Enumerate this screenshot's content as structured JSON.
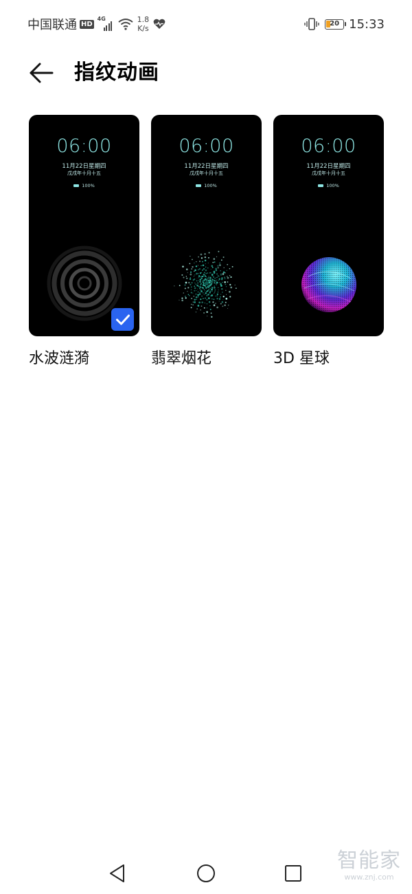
{
  "status_bar": {
    "carrier": "中国联通",
    "hd_badge": "HD",
    "network_type": "4G",
    "speed_value": "1.8",
    "speed_unit": "K/s",
    "battery_percent": "20",
    "time": "15:33",
    "icons": [
      "hd-badge",
      "signal-icon",
      "wifi-icon",
      "heart-rate-icon",
      "vibrate-icon",
      "battery-icon"
    ]
  },
  "header": {
    "title": "指纹动画",
    "back_icon": "arrow-left-icon"
  },
  "preview_common": {
    "time": "06:00",
    "date": "11月22日星期四",
    "lunar": "戊戌年十月十五",
    "battery": "100%"
  },
  "animations": [
    {
      "label": "水波涟漪",
      "selected": true
    },
    {
      "label": "翡翠烟花",
      "selected": false
    },
    {
      "label": "3D 星球",
      "selected": false
    }
  ],
  "colors": {
    "accent": "#2a64f0",
    "preview_text": "#8ee6e4",
    "battery_low": "#f0a020"
  },
  "nav_bar": {
    "icons": [
      "back-triangle-icon",
      "home-circle-icon",
      "recents-square-icon"
    ]
  },
  "watermark": {
    "logo": "智能家",
    "url": "www.znj.com"
  }
}
